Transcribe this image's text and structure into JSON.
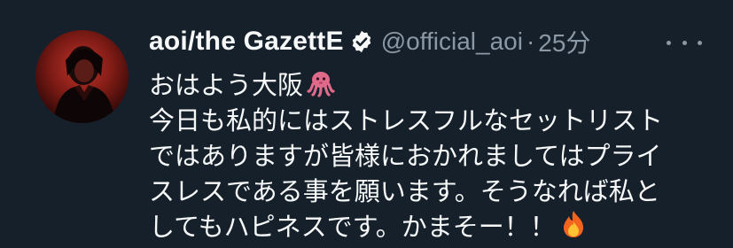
{
  "tweet": {
    "display_name": "aoi/the GazettE",
    "handle": "@official_aoi",
    "separator": "·",
    "time": "25分",
    "lines": [
      "おはよう大阪",
      "今日も私的にはストレスフルなセットリスト",
      "ではありますが皆様におかれましてはプライ",
      "スレスである事を願います。そうなれば私と",
      "してもハピネスです。かまそー！！"
    ],
    "emoji": [
      "octopus-emoji",
      "fire-emoji"
    ]
  },
  "icons": {
    "verified": "verified-badge-icon",
    "more": "more-options-icon"
  },
  "colors": {
    "background": "#15202b",
    "primary_text": "#f7f9f9",
    "secondary_text": "#8b98a5"
  }
}
